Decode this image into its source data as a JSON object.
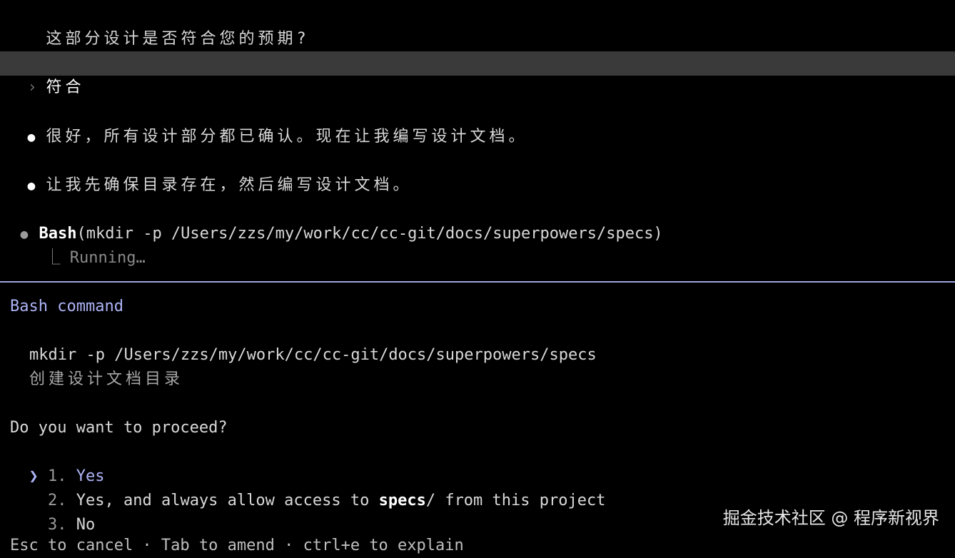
{
  "conversation": {
    "question": "这部分设计是否符合您的预期?",
    "user_input": {
      "chevron": "›",
      "text": "符合"
    },
    "messages": [
      {
        "bullet": "●",
        "text": "很好，所有设计部分都已确认。现在让我编写设计文档。"
      },
      {
        "bullet": "●",
        "text": "让我先确保目录存在，然后编写设计文档。"
      }
    ],
    "tool_call": {
      "bullet": "●",
      "tool_name": "Bash",
      "args": "(mkdir -p /Users/zzs/my/work/cc/cc-git/docs/superpowers/specs)",
      "status_prefix": "⎿",
      "status": "Running…"
    }
  },
  "permission_dialog": {
    "title": "Bash command",
    "command": "mkdir -p /Users/zzs/my/work/cc/cc-git/docs/superpowers/specs",
    "description": "创建设计文档目录",
    "question": "Do you want to proceed?",
    "selected_chevron": "❯",
    "options": [
      {
        "number": "1.",
        "label": "Yes"
      },
      {
        "number": "2.",
        "label_before": "Yes, and always allow access to ",
        "label_bold": "specs",
        "label_after": "/ from this project"
      },
      {
        "number": "3.",
        "label": "No"
      }
    ],
    "footer_partial": "Esc to cancel · Tab to amend · ctrl+e to explain"
  },
  "watermark": "掘金技术社区 @ 程序新视界",
  "colors": {
    "background": "#000000",
    "prompt_bar": "#3a3a3a",
    "accent": "#aeb4f7",
    "divider": "#9da3e0",
    "muted": "#8a8a8a"
  }
}
